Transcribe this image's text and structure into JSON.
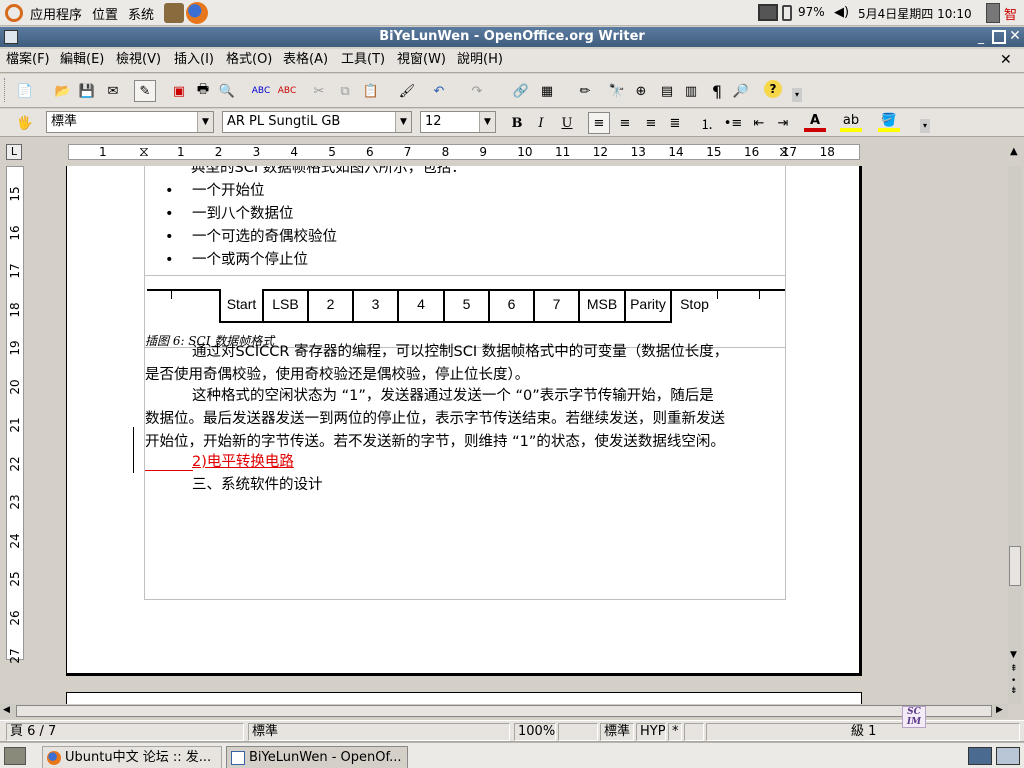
{
  "gnome_panel": {
    "applications": "应用程序",
    "places": "位置",
    "system": "系统",
    "battery": "97%",
    "datetime": "5月4日星期四 10:10",
    "input_method": "智"
  },
  "window": {
    "title": "BiYeLunWen - OpenOffice.org Writer"
  },
  "menu": {
    "items": [
      "檔案(F)",
      "編輯(E)",
      "檢視(V)",
      "插入(I)",
      "格式(O)",
      "表格(A)",
      "工具(T)",
      "視窗(W)",
      "說明(H)"
    ]
  },
  "format_bar": {
    "style": "標準",
    "font": "AR PL SungtiL GB",
    "size": "12",
    "bold": "B",
    "italic": "I",
    "underline": "U"
  },
  "ruler": {
    "unit_button": "L",
    "h_numbers": [
      "1",
      "1",
      "2",
      "3",
      "4",
      "5",
      "6",
      "7",
      "8",
      "9",
      "10",
      "11",
      "12",
      "13",
      "14",
      "15",
      "16",
      "17",
      "18"
    ],
    "v_numbers": [
      "15",
      "16",
      "17",
      "18",
      "19",
      "20",
      "21",
      "22",
      "23",
      "24",
      "25",
      "26",
      "27"
    ]
  },
  "document": {
    "intro_line": "典型的SCI 数据帧格式如图六所示，包括：",
    "bullets": [
      "一个开始位",
      "一到八个数据位",
      "一个可选的奇偶校验位",
      "一个或两个停止位"
    ],
    "frame_cells": [
      "Start",
      "LSB",
      "2",
      "3",
      "4",
      "5",
      "6",
      "7",
      "MSB",
      "Parity",
      "Stop"
    ],
    "caption": "插图 6:  SCI 数据帧格式",
    "para1_line1": "通过对SCICCR 寄存器的编程，可以控制SCI 数据帧格式中的可变量（数据位长度，",
    "para1_line2": "是否使用奇偶校验，使用奇校验还是偶校验，停止位长度）。",
    "para2_line1": "这种格式的空闲状态为 “1”，发送器通过发送一个 “0”表示字节传输开始，随后是",
    "para2_line2": "数据位。最后发送器发送一到两位的停止位，表示字节传送结束。若继续发送，则重新发送",
    "para2_line3": "开始位，开始新的字节传送。若不发送新的字节，则维持 “1”的状态，使发送数据线空闲。",
    "heading_red": "2)电平转换电路",
    "heading3": "三、系统软件的设计"
  },
  "status_bar": {
    "page": "頁 6 / 7",
    "style": "標準",
    "zoom": "100%",
    "mode": "標準",
    "hyp": "HYP",
    "modified": "*",
    "level": "級 1"
  },
  "taskbar": {
    "tasks": [
      "Ubuntu中文 论坛 :: 发...",
      "BiYeLunWen - OpenOf..."
    ]
  },
  "colors": {
    "title_bar": "#3f5d7d",
    "red_heading": "#e00000",
    "workspace": "#d4d0c8"
  }
}
